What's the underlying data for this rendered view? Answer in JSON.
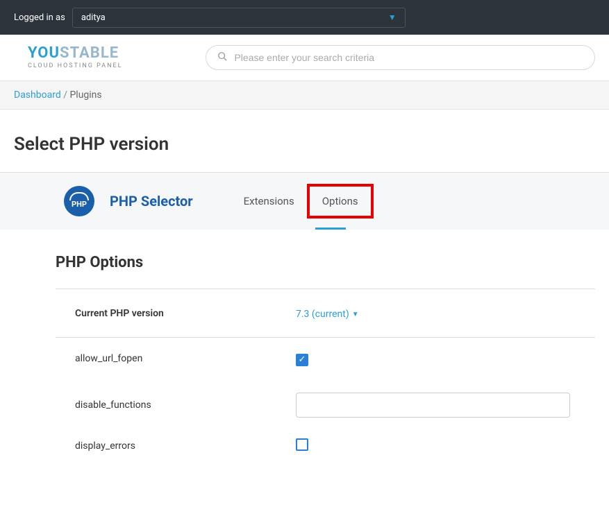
{
  "topbar": {
    "logged_in_label": "Logged in as",
    "user": "aditya"
  },
  "logo": {
    "part1": "YOU",
    "part2": "STABLE",
    "subtitle": "CLOUD HOSTING PANEL"
  },
  "search": {
    "placeholder": "Please enter your search criteria"
  },
  "breadcrumb": {
    "link": "Dashboard",
    "current": "Plugins"
  },
  "page_title": "Select PHP version",
  "selector": {
    "badge_text": "PHP",
    "title": "PHP Selector",
    "tabs": [
      {
        "label": "Extensions"
      },
      {
        "label": "Options"
      }
    ]
  },
  "section_title": "PHP Options",
  "options": {
    "current_version": {
      "label": "Current PHP version",
      "value": "7.3 (current)"
    },
    "controls": [
      {
        "name": "allow_url_fopen",
        "type": "checkbox",
        "checked": true
      },
      {
        "name": "disable_functions",
        "type": "text",
        "value": ""
      },
      {
        "name": "display_errors",
        "type": "checkbox",
        "checked": false
      }
    ]
  }
}
